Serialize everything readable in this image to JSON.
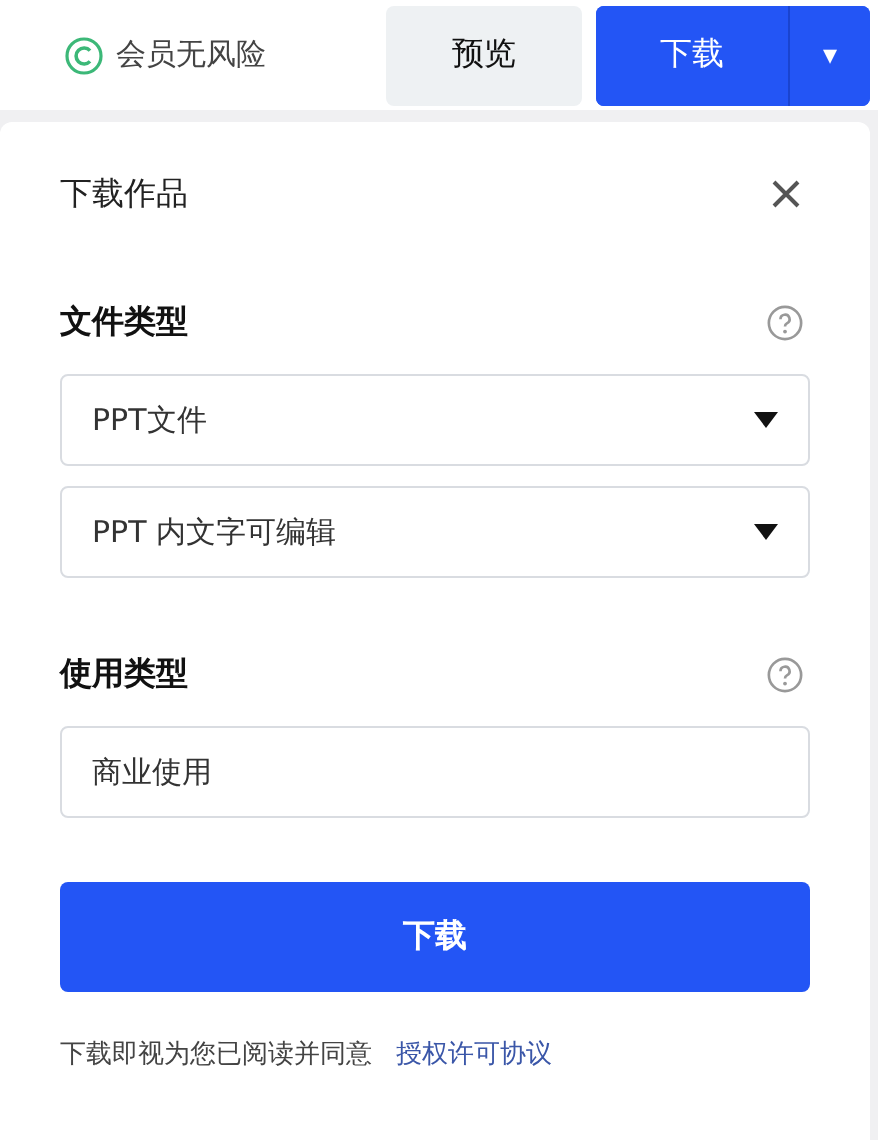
{
  "top_bar": {
    "guarantee": "会员无风险",
    "preview_button": "预览",
    "download_button": "下载",
    "dropdown_icon": "▾"
  },
  "panel": {
    "title": "下载作品",
    "sections": [
      {
        "title": "文件类型",
        "fields": [
          {
            "kind": "select",
            "value": "PPT文件"
          },
          {
            "kind": "select",
            "value": "PPT 内文字可编辑"
          }
        ]
      },
      {
        "title": "使用类型",
        "fields": [
          {
            "kind": "text",
            "value": "商业使用"
          }
        ]
      }
    ],
    "download_button": "下载",
    "agreement_text": "下载即视为您已阅读并同意",
    "agreement_link": "授权许可协议"
  }
}
